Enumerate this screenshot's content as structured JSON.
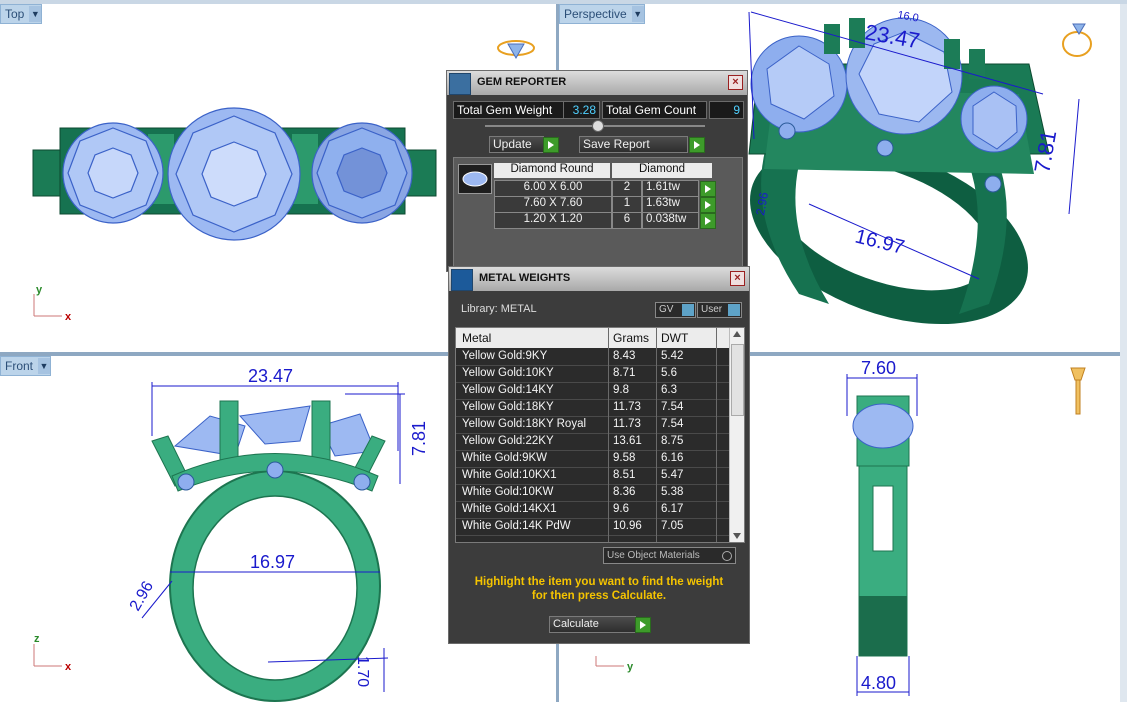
{
  "viewports": {
    "top": {
      "label": "Top"
    },
    "perspective": {
      "label": "Perspective"
    },
    "front": {
      "label": "Front"
    },
    "right": {
      "label": ""
    }
  },
  "dimensions": {
    "persp_width": "23.47",
    "persp_top_small": "16.0",
    "persp_height": "7.81",
    "persp_inner": "16.97",
    "persp_side": "2.96",
    "front_width": "23.47",
    "front_height": "7.81",
    "front_inner": "16.97",
    "front_side": "2.96",
    "front_bottom": "1.70",
    "right_top": "7.60",
    "right_bottom": "4.80"
  },
  "axes": {
    "x": "x",
    "y": "y",
    "z": "z"
  },
  "gem_reporter": {
    "title": "GEM REPORTER",
    "total_weight_label": "Total Gem Weight",
    "total_weight_value": "3.28",
    "total_count_label": "Total Gem Count",
    "total_count_value": "9",
    "update_label": "Update",
    "save_label": "Save Report",
    "header_shape": "Diamond Round",
    "header_material": "Diamond",
    "rows": [
      {
        "size": "6.00 X 6.00",
        "count": "2",
        "weight": "1.61tw"
      },
      {
        "size": "7.60 X 7.60",
        "count": "1",
        "weight": "1.63tw"
      },
      {
        "size": "1.20 X 1.20",
        "count": "6",
        "weight": "0.038tw"
      }
    ]
  },
  "metal_weights": {
    "title": "METAL WEIGHTS",
    "library": "Library: METAL",
    "gv": "GV",
    "user": "User",
    "headers": {
      "metal": "Metal",
      "grams": "Grams",
      "dwt": "DWT"
    },
    "rows": [
      {
        "metal": "Yellow Gold:9KY",
        "grams": "8.43",
        "dwt": "5.42"
      },
      {
        "metal": "Yellow Gold:10KY",
        "grams": "8.71",
        "dwt": "5.6"
      },
      {
        "metal": "Yellow Gold:14KY",
        "grams": "9.8",
        "dwt": "6.3"
      },
      {
        "metal": "Yellow Gold:18KY",
        "grams": "11.73",
        "dwt": "7.54"
      },
      {
        "metal": "Yellow Gold:18KY Royal",
        "grams": "11.73",
        "dwt": "7.54"
      },
      {
        "metal": "Yellow Gold:22KY",
        "grams": "13.61",
        "dwt": "8.75"
      },
      {
        "metal": "White Gold:9KW",
        "grams": "9.58",
        "dwt": "6.16"
      },
      {
        "metal": "White Gold:10KX1",
        "grams": "8.51",
        "dwt": "5.47"
      },
      {
        "metal": "White Gold:10KW",
        "grams": "8.36",
        "dwt": "5.38"
      },
      {
        "metal": "White Gold:14KX1",
        "grams": "9.6",
        "dwt": "6.17"
      },
      {
        "metal": "White Gold:14K PdW",
        "grams": "10.96",
        "dwt": "7.05"
      }
    ],
    "use_object_materials": "Use Object Materials",
    "hint": "Highlight the item you want to find the weight for then press Calculate.",
    "calculate_label": "Calculate"
  },
  "colors": {
    "metal_dark": "#15724f",
    "metal_light": "#3cae83",
    "gem": "#9cb8f0",
    "dim": "#1a1acc"
  }
}
